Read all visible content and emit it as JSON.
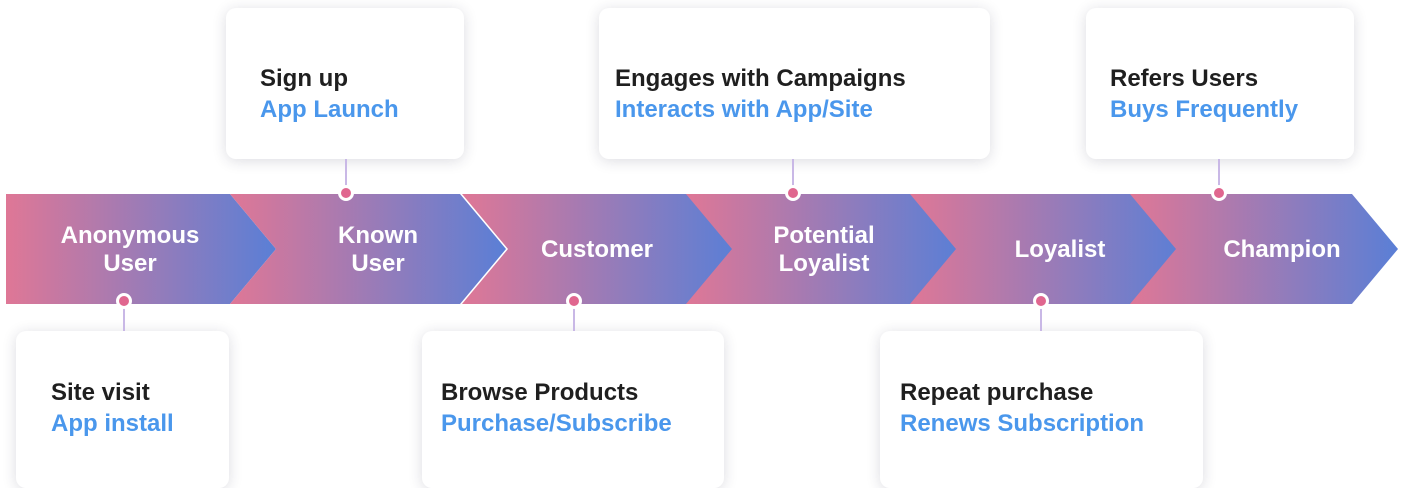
{
  "colors": {
    "gradient_start": "#df7796",
    "gradient_end": "#5a7fd6",
    "dot": "#e0668f",
    "connector": "#c9b8e6",
    "event_primary": "#1f1f1f",
    "event_secondary": "#4a97ec"
  },
  "stages": [
    {
      "label_lines": [
        "Anonymous",
        "User"
      ]
    },
    {
      "label_lines": [
        "Known",
        "User"
      ]
    },
    {
      "label_lines": [
        "Customer"
      ]
    },
    {
      "label_lines": [
        "Potential",
        "Loyalist"
      ]
    },
    {
      "label_lines": [
        "Loyalist"
      ]
    },
    {
      "label_lines": [
        "Champion"
      ]
    }
  ],
  "cards": [
    {
      "stage": "Anonymous User",
      "primary": "Site visit",
      "secondary": "App install"
    },
    {
      "stage": "Known User",
      "primary": "Sign up",
      "secondary": "App Launch"
    },
    {
      "stage": "Customer",
      "primary": "Browse Products",
      "secondary": "Purchase/Subscribe"
    },
    {
      "stage": "Potential Loyalist",
      "primary": "Engages with Campaigns",
      "secondary": "Interacts with App/Site"
    },
    {
      "stage": "Loyalist",
      "primary": "Repeat purchase",
      "secondary": "Renews Subscription"
    },
    {
      "stage": "Champion",
      "primary": "Refers Users",
      "secondary": "Buys Frequently"
    }
  ]
}
